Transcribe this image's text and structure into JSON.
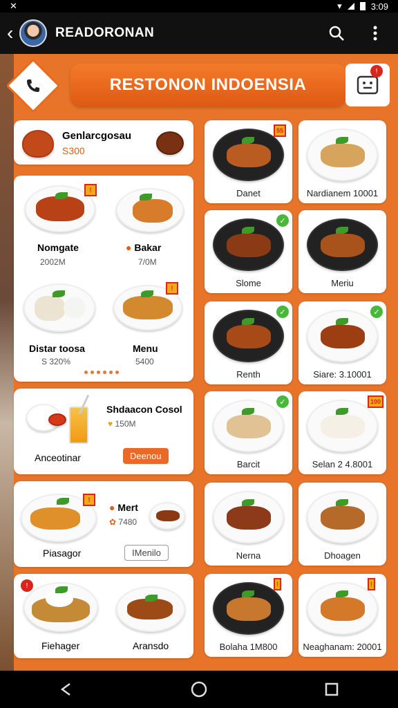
{
  "status": {
    "time": "3:09"
  },
  "app_bar": {
    "title": "READORONAN"
  },
  "banner": {
    "title": "RESTONON INDOENSIA",
    "cart_badge": "!"
  },
  "left_cards": {
    "top": {
      "name": "Genlarcgosau",
      "price": "S300"
    },
    "grid": [
      {
        "name": "Nomgate",
        "price": "2002M"
      },
      {
        "name": "Bakar",
        "price": "7/0M"
      },
      {
        "name": "Distar toosa",
        "price": "S 320%"
      },
      {
        "name": "Menu",
        "price": "5400"
      }
    ],
    "drink": {
      "name": "Shdaacon Cosol",
      "price": "150M",
      "label": "Anceotinar",
      "button": "Deenou"
    },
    "plantain": {
      "name": "Piasagor",
      "side_name": "Mert",
      "side_price": "7480",
      "button": "IMenilo"
    },
    "bottom": {
      "left": "Fiehager",
      "right": "Aransdo",
      "badge": "!"
    }
  },
  "right_grid": [
    {
      "label": "Danet",
      "badge": "55"
    },
    {
      "label": "Nardianem 10001"
    },
    {
      "label": "Slome"
    },
    {
      "label": "Meriu"
    },
    {
      "label": "Renth"
    },
    {
      "label": "Siare: 3.10001"
    },
    {
      "label": "Barcit"
    },
    {
      "label": "Selan 2 4.8001",
      "badge": "100"
    },
    {
      "label": "Nerna"
    },
    {
      "label": "Dhoagen"
    },
    {
      "label": "Bolaha 1M800",
      "badge": "!"
    },
    {
      "label": "Neaghanam: 20001",
      "badge": "!"
    }
  ],
  "colors": {
    "accent": "#e8742a",
    "banner": "#dd5a14",
    "check": "#48b83a"
  }
}
